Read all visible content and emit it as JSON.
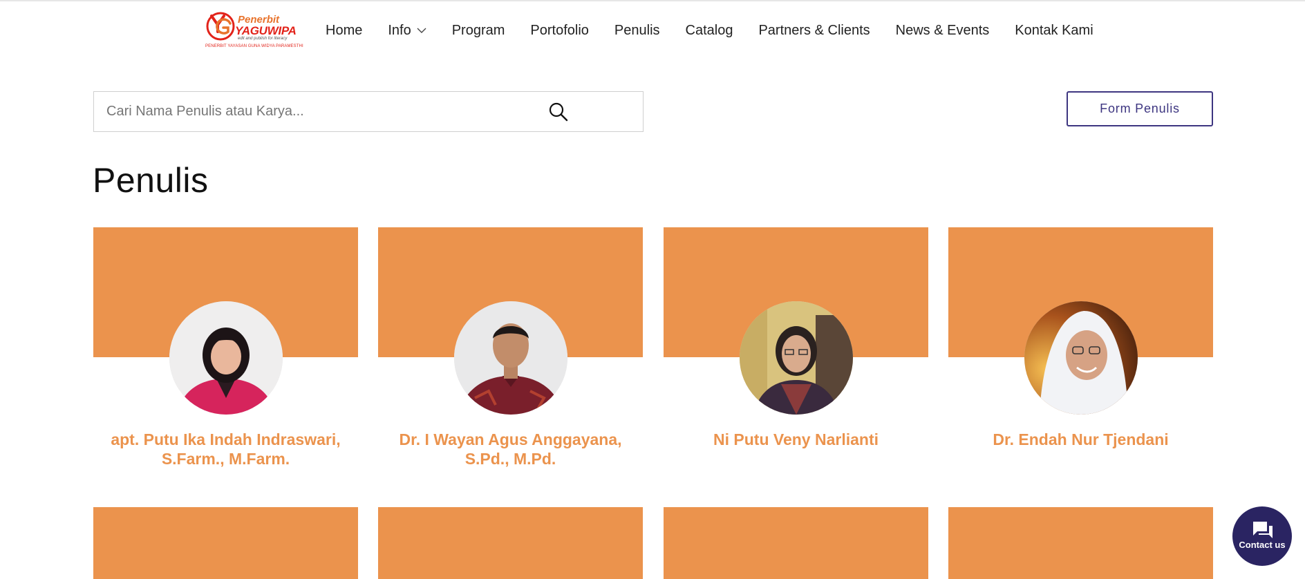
{
  "brand": {
    "mark": "YG",
    "line1": "Penerbit",
    "line2": "YAGUWIPA",
    "tagline": "edit and publish for literacy",
    "subline": "PENERBIT YAYASAN GUNA WIDYA PARAMESTHI",
    "colors": {
      "red": "#e2231a",
      "orange": "#e8732c"
    }
  },
  "nav": {
    "items": [
      {
        "label": "Home"
      },
      {
        "label": "Info",
        "has_dropdown": true
      },
      {
        "label": "Program"
      },
      {
        "label": "Portofolio"
      },
      {
        "label": "Penulis"
      },
      {
        "label": "Catalog"
      },
      {
        "label": "Partners & Clients"
      },
      {
        "label": "News & Events"
      },
      {
        "label": "Kontak Kami"
      }
    ]
  },
  "search": {
    "placeholder": "Cari Nama Penulis atau Karya...",
    "value": "",
    "icon": "search-icon"
  },
  "form_button": {
    "label": "Form Penulis"
  },
  "page_title": "Penulis",
  "authors": [
    {
      "name": "apt. Putu Ika Indah Indraswari, S.Farm., M.Farm."
    },
    {
      "name": "Dr. I Wayan Agus Anggayana, S.Pd., M.Pd."
    },
    {
      "name": "Ni Putu Veny Narlianti"
    },
    {
      "name": "Dr. Endah Nur Tjendani"
    }
  ],
  "contact": {
    "label": "Contact us",
    "icon": "chat-icon"
  },
  "colors": {
    "accent": "#eb934d",
    "primary": "#3d3580",
    "fab": "#2a2462"
  }
}
